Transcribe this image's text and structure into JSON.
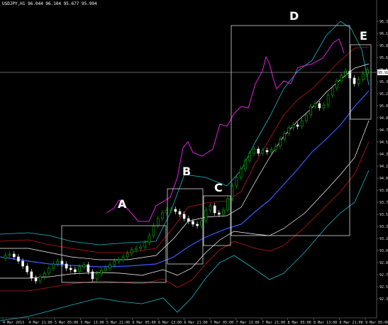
{
  "header": {
    "text": "USDJPY,H1  96.044 96.104 95.677 95.994"
  },
  "price_axis": {
    "labels": [
      "96.355",
      "96.190",
      "95.860",
      "95.695",
      "95.530",
      "95.365",
      "95.200",
      "95.035",
      "94.870",
      "94.705",
      "94.540",
      "94.375",
      "94.210",
      "94.045",
      "93.880",
      "93.715",
      "93.550",
      "93.385",
      "93.220",
      "93.055",
      "92.890",
      "92.725",
      "92.560",
      "92.395"
    ],
    "current": "95.924"
  },
  "time_axis": {
    "labels": [
      "4 Mar 2013",
      "4 Mar 21:00",
      "5 Mar 05:00",
      "5 Mar 13:00",
      "5 Mar 21:00",
      "6 Mar 05:00",
      "6 Mar 13:00",
      "6 Mar 21:00",
      "7 Mar 05:00",
      "7 Mar 13:00",
      "7 Mar 21:00",
      "8 Mar 05:00",
      "8 Mar 13:00",
      "8 Mar 21:00",
      "9 Mar 05:00"
    ]
  },
  "annotations": {
    "boxes": [
      {
        "label": "A"
      },
      {
        "label": "B"
      },
      {
        "label": "C"
      },
      {
        "label": "D"
      },
      {
        "label": "E"
      }
    ]
  },
  "colors": {
    "background": "#000000",
    "bull_candle": "#00c000",
    "bear_candle": "#ffffff",
    "band_outer": "#20b8c8",
    "band_inner": "#ffffff",
    "band_mid": "#c01818",
    "ma": "#3a5cff",
    "magenta": "#e020e0",
    "box": "#d8d8d8"
  }
}
